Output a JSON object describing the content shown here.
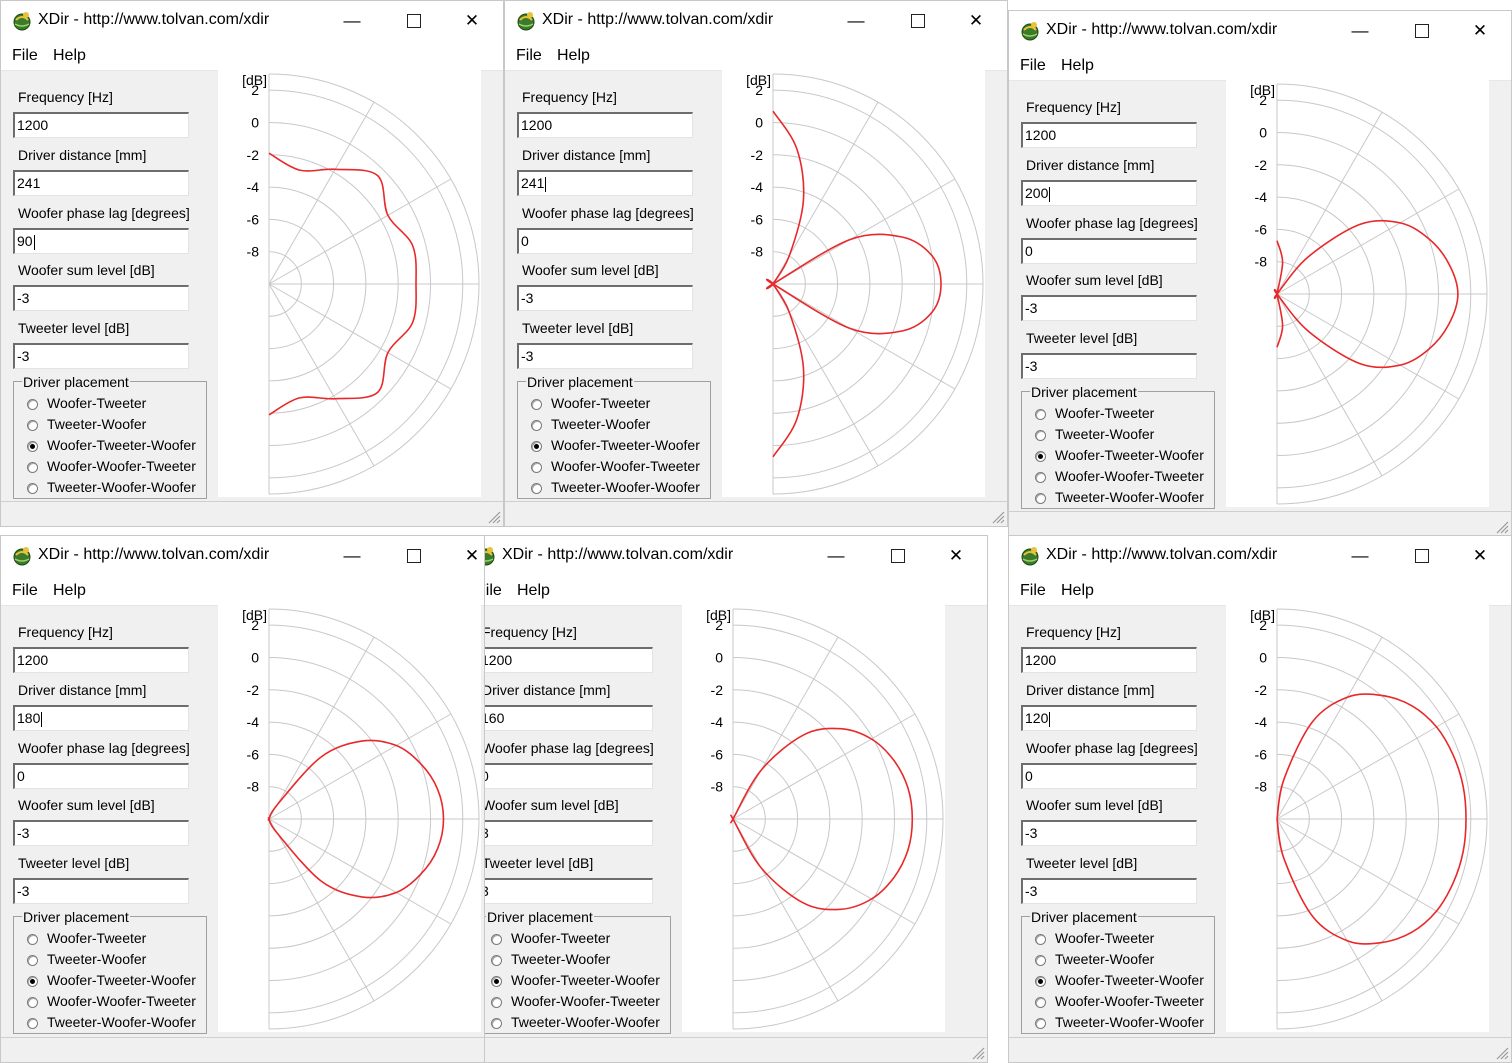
{
  "app_title": "XDir - http://www.tolvan.com/xdir",
  "window_controls": {
    "minimize": "—",
    "close": "✕"
  },
  "menu": {
    "file": "File",
    "help": "Help"
  },
  "labels": {
    "frequency": "Frequency [Hz]",
    "distance": "Driver distance [mm]",
    "phase": "Woofer phase lag [degrees]",
    "woofer_level": "Woofer sum level [dB]",
    "tweeter_level": "Tweeter level [dB]",
    "placement": "Driver placement",
    "unit": "[dB]"
  },
  "placement_options": [
    "Woofer-Tweeter",
    "Tweeter-Woofer",
    "Woofer-Tweeter-Woofer",
    "Woofer-Woofer-Tweeter",
    "Tweeter-Woofer-Woofer"
  ],
  "y_ticks": [
    "2",
    "0",
    "-2",
    "-4",
    "-6",
    "-8"
  ],
  "colors": {
    "response": "#e8282a",
    "grid": "#c8c8c8"
  },
  "icons": {
    "app": "xdir-app-icon",
    "minimize": "minimize-icon",
    "maximize": "maximize-icon",
    "close": "close-icon",
    "grip": "resize-grip-icon"
  },
  "windows": [
    {
      "frequency": "1200",
      "distance": "241",
      "phase": "90",
      "woofer_level": "-3",
      "tweeter_level": "-3",
      "selected": 2,
      "chart_data": {
        "type": "polar",
        "r_unit": "dB",
        "r_range": [
          -10,
          3
        ],
        "angle_range_deg": [
          -90,
          90
        ],
        "response": [
          [
            90,
            -1.9
          ],
          [
            75,
            -2.7
          ],
          [
            60,
            -1.8
          ],
          [
            45,
            -0.5
          ],
          [
            30,
            -1.5
          ],
          [
            15,
            -0.8
          ],
          [
            0,
            -0.9
          ],
          [
            -15,
            -0.8
          ],
          [
            -30,
            -1.5
          ],
          [
            -45,
            -0.5
          ],
          [
            -60,
            -1.8
          ],
          [
            -75,
            -2.7
          ],
          [
            -90,
            -1.9
          ]
        ]
      }
    },
    {
      "frequency": "1200",
      "distance": "241",
      "phase": "0",
      "woofer_level": "-3",
      "tweeter_level": "-3",
      "selected": 2,
      "chart_data": {
        "type": "polar",
        "r_unit": "dB",
        "r_range": [
          -10,
          3
        ],
        "angle_range_deg": [
          -90,
          90
        ],
        "response": [
          [
            90,
            0.7
          ],
          [
            80,
            -1.5
          ],
          [
            70,
            -4.5
          ],
          [
            60,
            -8
          ],
          [
            50,
            -11
          ],
          [
            40,
            -11
          ],
          [
            30,
            -4.5
          ],
          [
            20,
            -1.5
          ],
          [
            10,
            0
          ],
          [
            0,
            0.4
          ],
          [
            -10,
            0
          ],
          [
            -20,
            -1.5
          ],
          [
            -30,
            -4.5
          ],
          [
            -40,
            -11
          ],
          [
            -50,
            -11
          ],
          [
            -60,
            -8
          ],
          [
            -70,
            -4.5
          ],
          [
            -80,
            -1.5
          ],
          [
            -90,
            0.7
          ]
        ]
      }
    },
    {
      "frequency": "1200",
      "distance": "200",
      "phase": "0",
      "woofer_level": "-3",
      "tweeter_level": "-3",
      "selected": 2,
      "chart_data": {
        "type": "polar",
        "r_unit": "dB",
        "r_range": [
          -10,
          3
        ],
        "angle_range_deg": [
          -90,
          90
        ],
        "response": [
          [
            90,
            -6.7
          ],
          [
            80,
            -8
          ],
          [
            70,
            -11
          ],
          [
            60,
            -11
          ],
          [
            50,
            -7
          ],
          [
            40,
            -3.3
          ],
          [
            30,
            -1.2
          ],
          [
            20,
            0
          ],
          [
            10,
            0.8
          ],
          [
            0,
            1.2
          ],
          [
            -10,
            0.8
          ],
          [
            -20,
            0
          ],
          [
            -30,
            -1.2
          ],
          [
            -40,
            -3.3
          ],
          [
            -50,
            -7
          ],
          [
            -60,
            -11
          ],
          [
            -70,
            -11
          ],
          [
            -80,
            -8
          ],
          [
            -90,
            -6.7
          ]
        ]
      }
    },
    {
      "frequency": "1200",
      "distance": "180",
      "phase": "0",
      "woofer_level": "-3",
      "tweeter_level": "-3",
      "selected": 2,
      "chart_data": {
        "type": "polar",
        "r_unit": "dB",
        "r_range": [
          -10,
          3
        ],
        "angle_range_deg": [
          -90,
          90
        ],
        "response": [
          [
            90,
            -11
          ],
          [
            70,
            -11
          ],
          [
            60,
            -9
          ],
          [
            50,
            -5
          ],
          [
            40,
            -2.5
          ],
          [
            30,
            -0.9
          ],
          [
            20,
            0
          ],
          [
            10,
            0.6
          ],
          [
            0,
            0.8
          ],
          [
            -10,
            0.6
          ],
          [
            -20,
            0
          ],
          [
            -30,
            -0.9
          ],
          [
            -40,
            -2.5
          ],
          [
            -50,
            -5
          ],
          [
            -60,
            -9
          ],
          [
            -70,
            -11
          ],
          [
            -90,
            -11
          ]
        ]
      }
    },
    {
      "frequency": "1200",
      "distance": "160",
      "phase": "0",
      "woofer_level": "3",
      "tweeter_level": "3",
      "selected": 2,
      "chart_data": {
        "type": "polar",
        "r_unit": "dB",
        "r_range": [
          -10,
          3
        ],
        "angle_range_deg": [
          -90,
          90
        ],
        "response": [
          [
            90,
            -11
          ],
          [
            70,
            -11
          ],
          [
            60,
            -6.5
          ],
          [
            50,
            -3.2
          ],
          [
            40,
            -1.3
          ],
          [
            30,
            -0.1
          ],
          [
            20,
            0.6
          ],
          [
            10,
            1
          ],
          [
            0,
            1.1
          ],
          [
            -10,
            1
          ],
          [
            -20,
            0.6
          ],
          [
            -30,
            -0.1
          ],
          [
            -40,
            -1.3
          ],
          [
            -50,
            -3.2
          ],
          [
            -60,
            -6.5
          ],
          [
            -70,
            -11
          ],
          [
            -90,
            -11
          ]
        ]
      }
    },
    {
      "frequency": "1200",
      "distance": "120",
      "phase": "0",
      "woofer_level": "-3",
      "tweeter_level": "-3",
      "selected": 2,
      "chart_data": {
        "type": "polar",
        "r_unit": "dB",
        "r_range": [
          -10,
          3
        ],
        "angle_range_deg": [
          -90,
          90
        ],
        "response": [
          [
            90,
            -11
          ],
          [
            80,
            -7.5
          ],
          [
            70,
            -3.6
          ],
          [
            60,
            -1.3
          ],
          [
            50,
            0
          ],
          [
            40,
            0.9
          ],
          [
            30,
            1.4
          ],
          [
            20,
            1.6
          ],
          [
            10,
            1.7
          ],
          [
            0,
            1.7
          ],
          [
            -10,
            1.7
          ],
          [
            -20,
            1.6
          ],
          [
            -30,
            1.4
          ],
          [
            -40,
            0.9
          ],
          [
            -50,
            0
          ],
          [
            -60,
            -1.3
          ],
          [
            -70,
            -3.6
          ],
          [
            -80,
            -7.5
          ],
          [
            -90,
            -11
          ]
        ]
      }
    }
  ]
}
